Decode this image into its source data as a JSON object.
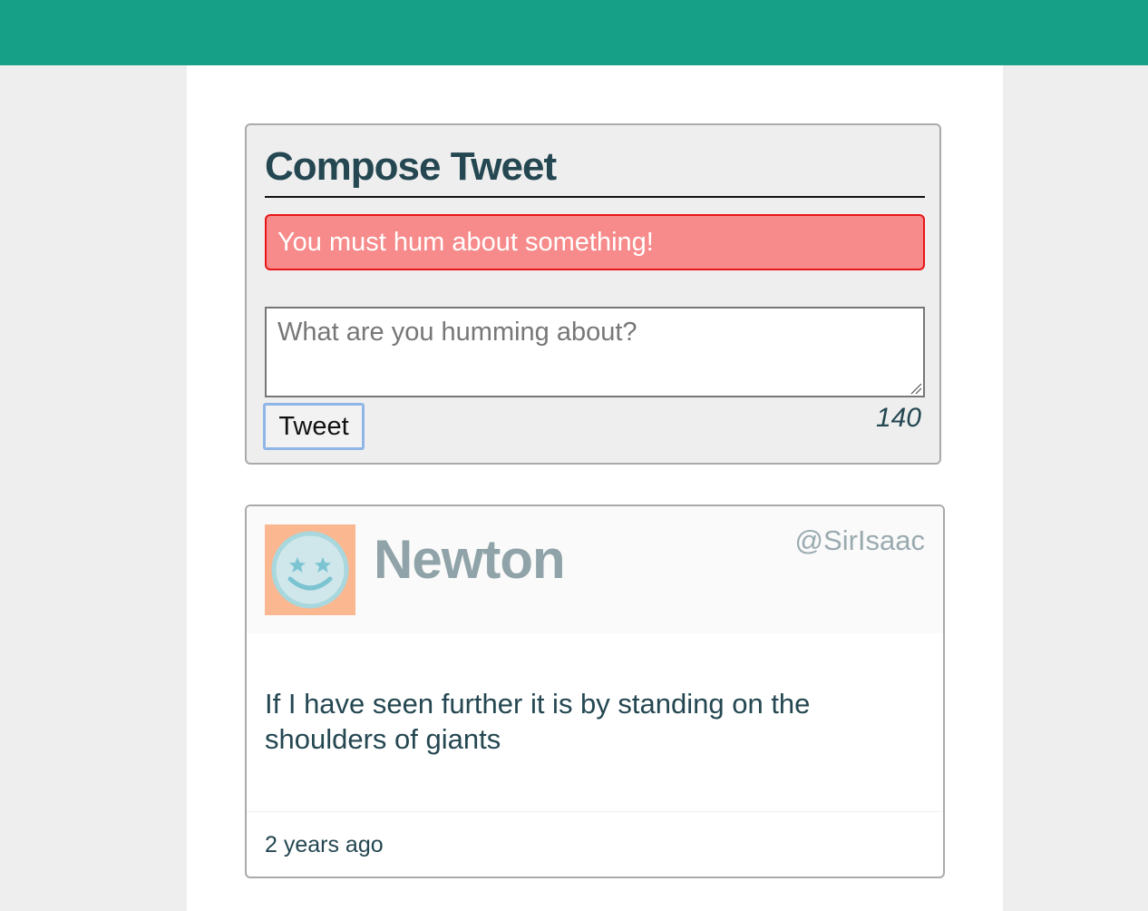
{
  "colors": {
    "header_bg": "#17a088",
    "page_bg": "#eeeeee",
    "content_bg": "#ffffff",
    "error_bg": "#f78a8a",
    "error_border": "#e8151a",
    "heading_text": "#244751",
    "muted_text": "#8fa3a8",
    "avatar_bg": "#fbb78f"
  },
  "compose": {
    "title": "Compose Tweet",
    "error_message": "You must hum about something!",
    "textarea_value": "",
    "textarea_placeholder": "What are you humming about?",
    "submit_label": "Tweet",
    "char_counter": "140"
  },
  "tweets": [
    {
      "avatar_icon": "smiley-star-eyes-icon",
      "display_name": "Newton",
      "handle": "@SirIsaac",
      "content": "If I have seen further it is by standing on the shoulders of giants",
      "timestamp": "2 years ago"
    }
  ]
}
